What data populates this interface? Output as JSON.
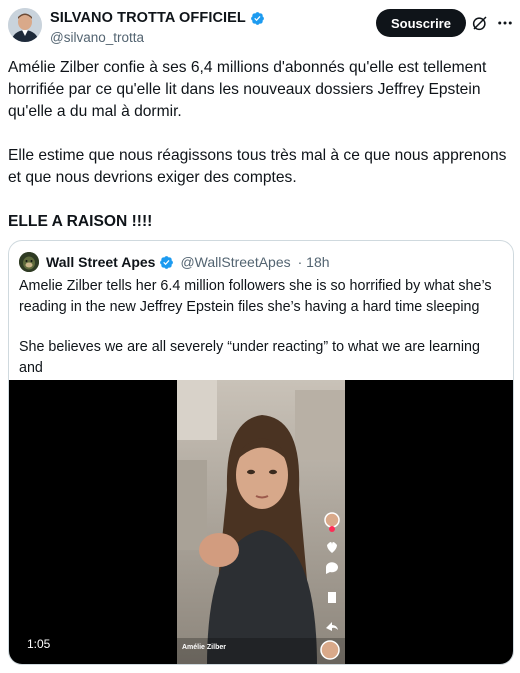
{
  "author": {
    "display_name": "SILVANO TROTTA OFFICIEL",
    "handle": "@silvano_trotta",
    "follow_label": "Souscrire"
  },
  "tweet": {
    "paragraphs": [
      "Amélie Zilber confie à ses 6,4 millions d'abonnés qu'elle est tellement\nhorrifiée par ce qu'elle lit dans les nouveaux dossiers Jeffrey Epstein\nqu'elle a du mal à dormir.",
      "Elle estime que nous réagissons tous très mal à ce que nous apprenons\net que nous devrions exiger des comptes.",
      "ELLE A RAISON !!!!"
    ]
  },
  "quoted": {
    "display_name": "Wall Street Apes",
    "handle": "@WallStreetApes",
    "time": "· 18h",
    "paragraphs": [
      "Amelie Zilber tells her 6.4 million followers she is so horrified by what she’s\nreading in the new Jeffrey Epstein files she’s having a hard time sleeping",
      "She believes we are all severely “under reacting” to what we are learning and\nshould be DEMANDING accountability"
    ],
    "video": {
      "duration": "1:05",
      "overlay_user": "Amélie Zilber"
    }
  },
  "colors": {
    "text": "#0f1419",
    "secondary": "#536471",
    "verified": "#1d9bf0",
    "border": "#cfd9de"
  },
  "icons": [
    "verified-badge-icon",
    "grok-icon",
    "more-icon",
    "heart-icon",
    "comment-icon",
    "bookmark-icon",
    "share-icon"
  ]
}
